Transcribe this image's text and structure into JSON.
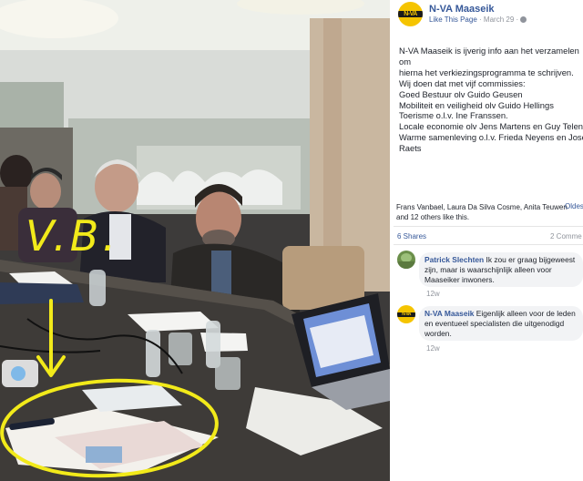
{
  "post": {
    "page_name": "N-VA Maaseik",
    "like_link": "Like This Page",
    "separator": "·",
    "date": "March 29",
    "privacy_icon": "globe-icon",
    "text": "N-VA Maaseik is ijverig info aan het verzamelen om\nhierna het verkiezingsprogramma te schrijven.\nWij doen dat met vijf commissies:\nGoed Bestuur olv Guido Geusen\nMobiliteit en veiligheid olv Guido Hellings\nToerisme o.l.v. Ine Franssen.\nLocale economie olv Jens Martens en Guy Telen\nWarme samenleving o.l.v. Frieda Neyens en José\nRaets"
  },
  "logo": {
    "text": "N-VA",
    "sub": "MAASEIK",
    "color": "#f5c400"
  },
  "reactions": {
    "likers": "Frans Vanbael, Laura Da Silva Cosme, Anita Teuwen and 12 others like this.",
    "older_link": "Oldes"
  },
  "counts": {
    "shares": "6 Shares",
    "comments": "2 Comme"
  },
  "comments": [
    {
      "author": "Patrick Slechten",
      "text": "Ik zou er graag bijgeweest zijn, maar is waarschijnlijk alleen voor Maaseiker inwoners.",
      "time": "12w"
    },
    {
      "author": "N-VA Maaseik",
      "text": "Eigenlijk alleen voor de leden en eventueel specialisten die uitgenodigd worden.",
      "time": "12w"
    }
  ],
  "annotation": {
    "text": "V.B.",
    "color": "#f2ea1a"
  },
  "colors": {
    "link": "#365899",
    "muted": "#90949c",
    "bubble": "#f2f3f5"
  }
}
